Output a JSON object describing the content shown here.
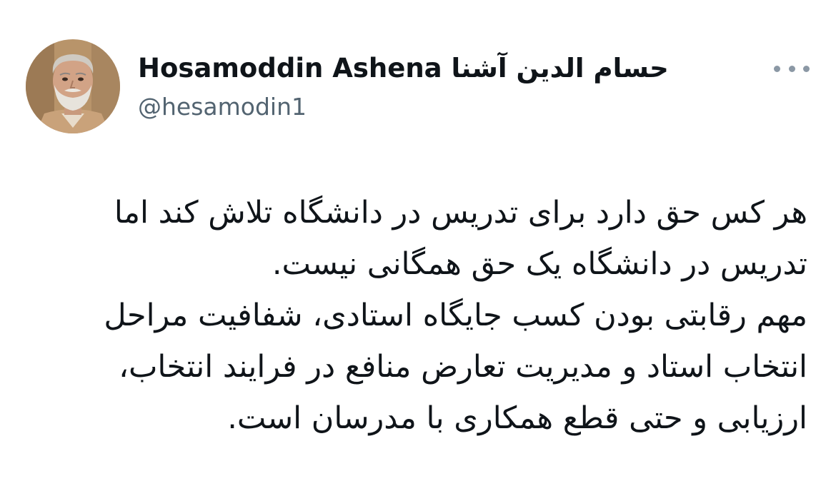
{
  "tweet": {
    "author": {
      "display_name": "Hosamoddin Ashena حسام الدین آشنا",
      "handle": "@hesamodin1"
    },
    "more_icon": "more-horizontal-icon",
    "text_lines": [
      "هر کس حق دارد برای تدریس در دانشگاه تلاش کند اما",
      "تدریس در دانشگاه یک حق همگانی نیست.",
      "مهم رقابتی بودن کسب جایگاه استادی، شفافیت مراحل",
      "انتخاب استاد و مدیریت تعارض منافع در فرایند انتخاب،",
      "ارزیابی و حتی قطع همکاری با مدرسان است."
    ]
  },
  "colors": {
    "text_primary": "#0f1419",
    "text_secondary": "#536471",
    "icon_gray": "#8b98a5",
    "background": "#ffffff"
  }
}
